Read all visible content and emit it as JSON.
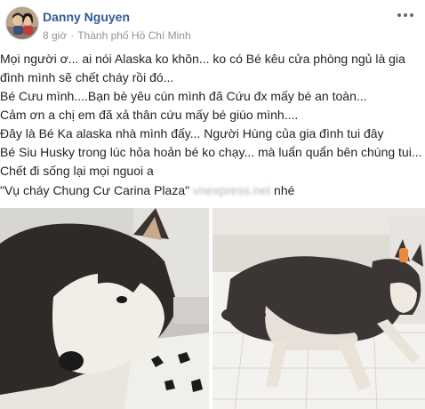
{
  "post": {
    "author": "Danny Nguyen",
    "time": "8 giờ",
    "separator": "·",
    "location": "Thành phố Hồ Chí Minh",
    "more_icon": "ellipsis-icon",
    "lines": [
      "Mọi người ơ... ai nói Alaska ko khôn... ko có Bé kêu cửa phòng ngủ là gia",
      "đình mình sẽ chết cháy rồi đó...",
      "Bé Cưu mình....Bạn bè yêu cún mình đã Cứu đx mấy bé an toàn...",
      "Cảm ơn a chị em đã xả thân cứu mấy bé giúo mình....",
      "Đây là Bé Ka alaska nhà mình đấy... Người Hùng của gia đình tui đây",
      "Bé Siu Husky trong lúc hỏa hoản bé ko chạy... mà luẩn quẩn bên chúng tui...",
      "Chết đi sống lại mọi nguoi a"
    ],
    "quote_text": "\"Vụ cháy Chung Cư Carina Plaza\"",
    "watermark_text": "vnexpress.net",
    "quote_suffix": " nhé",
    "photos": [
      {
        "name": "alaska-dog-photo",
        "subject": "Alaska dog lying on bed"
      },
      {
        "name": "husky-dog-photo",
        "subject": "Husky lying on tiled floor"
      }
    ]
  },
  "colors": {
    "author": "#365899",
    "meta": "#90949c",
    "text": "#1d2129"
  }
}
